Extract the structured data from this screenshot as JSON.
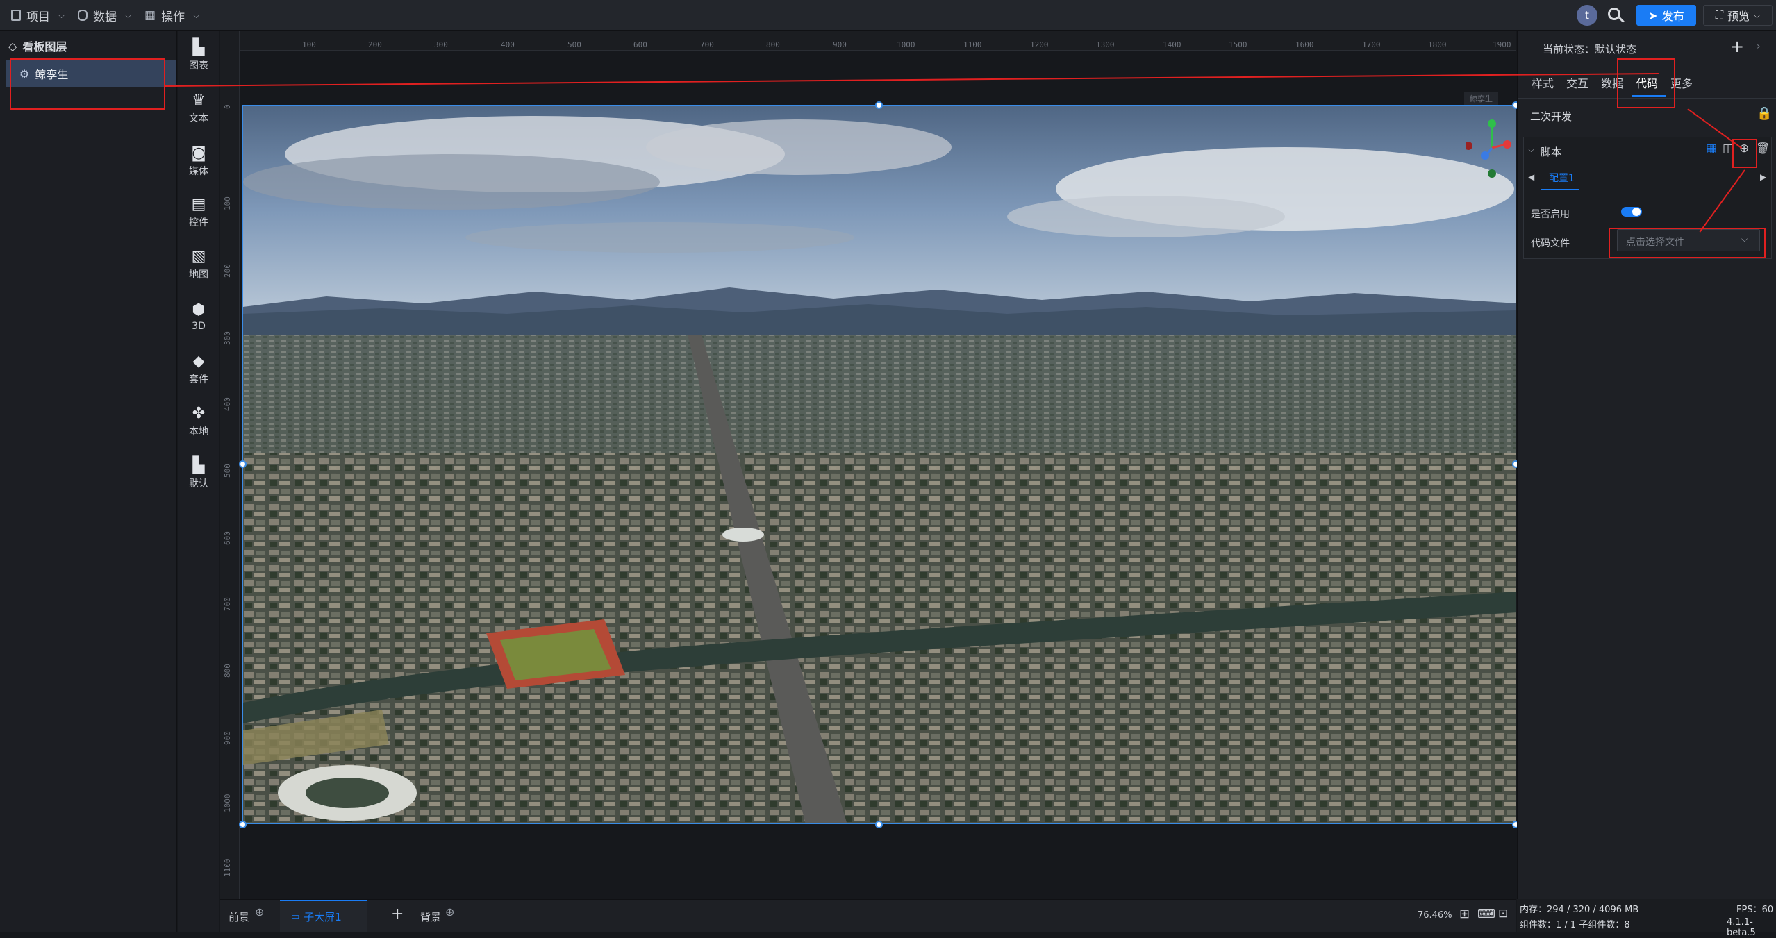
{
  "topbar": {
    "menu_project": "项目",
    "menu_data": "数据",
    "menu_operation": "操作",
    "avatar_letter": "t",
    "publish_label": "发布",
    "preview_label": "预览"
  },
  "layer_panel": {
    "title": "看板图层",
    "item_label": "鲸孪生"
  },
  "component_bar": {
    "items": [
      {
        "label": "图表",
        "icon": "chart-icon"
      },
      {
        "label": "文本",
        "icon": "text-icon"
      },
      {
        "label": "媒体",
        "icon": "media-icon"
      },
      {
        "label": "控件",
        "icon": "control-icon"
      },
      {
        "label": "地图",
        "icon": "map-icon"
      },
      {
        "label": "3D",
        "icon": "cube-icon"
      },
      {
        "label": "套件",
        "icon": "kit-icon"
      },
      {
        "label": "本地",
        "icon": "puzzle-icon"
      },
      {
        "label": "默认",
        "icon": "default-chart-icon"
      }
    ]
  },
  "ruler": {
    "h_ticks": [
      "100",
      "200",
      "300",
      "400",
      "500",
      "600",
      "700",
      "800",
      "900",
      "1000",
      "1100",
      "1200",
      "1300",
      "1400",
      "1500",
      "1600",
      "1700",
      "1800",
      "1900"
    ],
    "v_ticks": [
      "0",
      "100",
      "200",
      "300",
      "400",
      "500",
      "600",
      "700",
      "800",
      "900",
      "1000",
      "1100"
    ]
  },
  "scene": {
    "label": "鲸孪生"
  },
  "bottombar": {
    "foreground_label": "前景",
    "screen_tab_label": "子大屏1",
    "background_label": "背景",
    "zoom": "76.46%"
  },
  "right_panel": {
    "state_label": "当前状态：默认状态",
    "tabs": [
      "样式",
      "交互",
      "数据",
      "代码",
      "更多"
    ],
    "active_tab": "代码",
    "section_title": "二次开发",
    "script_title": "脚本",
    "config_tab": "配置1",
    "enable_label": "是否启用",
    "enable_value": true,
    "code_file_label": "代码文件",
    "code_file_placeholder": "点击选择文件"
  },
  "status": {
    "memory": "内存：294 / 320 / 4096 MB",
    "fps": "FPS：60",
    "components": "组件数：1 / 1    子组件数：8",
    "version": "4.1.1-beta.5"
  },
  "colors": {
    "accent": "#1a7cf5",
    "annotation": "#e02020",
    "selected_layer": "#34435c"
  }
}
